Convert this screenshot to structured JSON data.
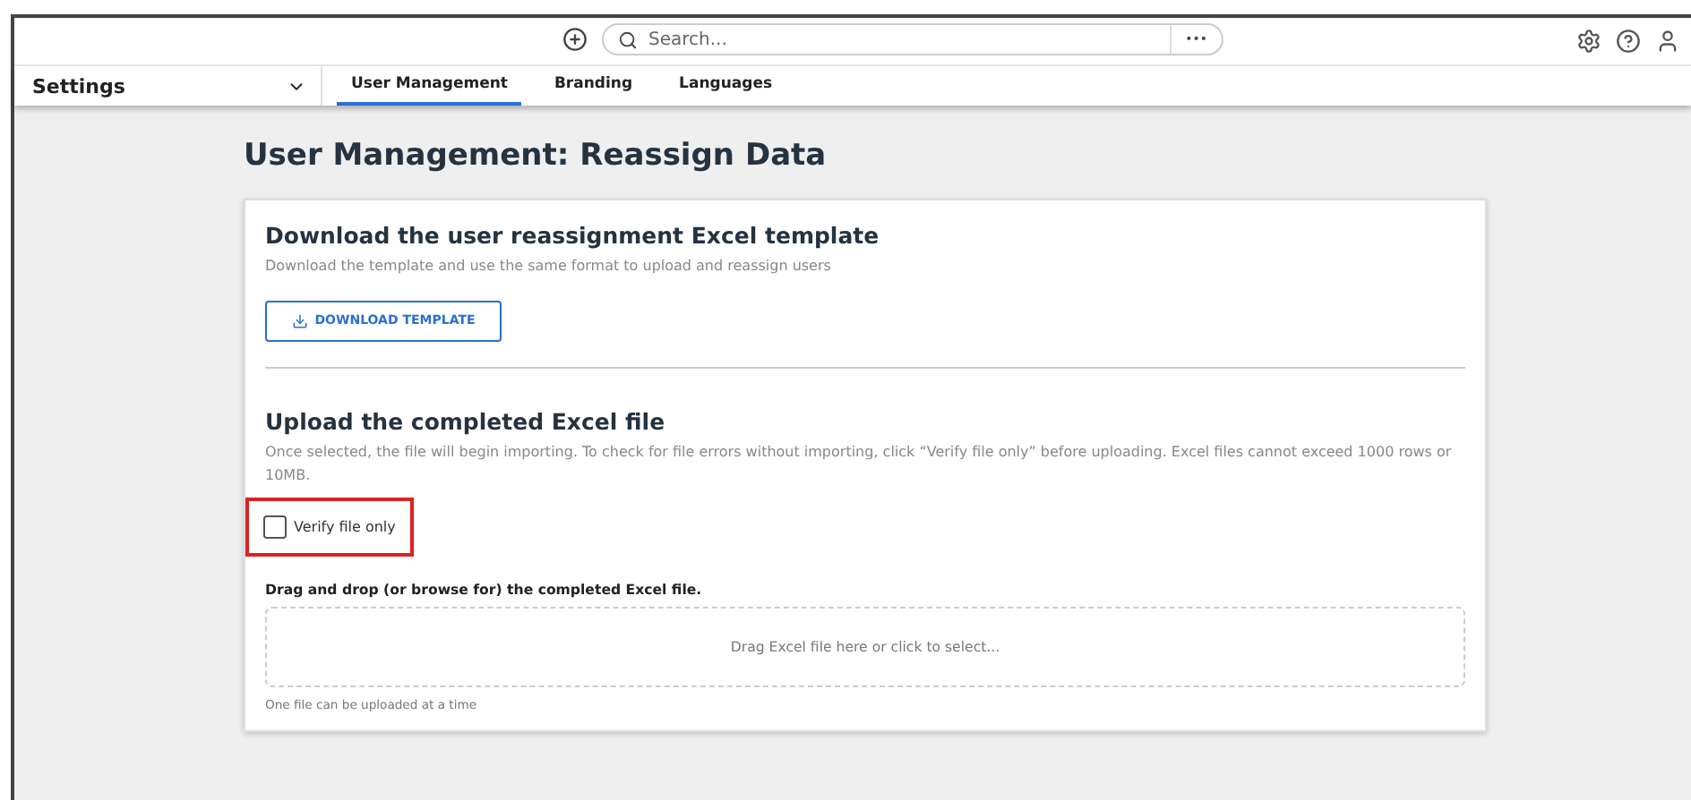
{
  "topbar": {
    "search": {
      "placeholder": "Search..."
    },
    "more": "•••"
  },
  "nav": {
    "title": "Settings",
    "tabs": [
      {
        "label": "User Management",
        "selected": true
      },
      {
        "label": "Branding",
        "selected": false
      },
      {
        "label": "Languages",
        "selected": false
      }
    ]
  },
  "page": {
    "title": "User Management: Reassign Data",
    "download": {
      "heading": "Download the user reassignment Excel template",
      "description": "Download the template and use the same format to upload and reassign users",
      "button": "DOWNLOAD TEMPLATE"
    },
    "upload": {
      "heading": "Upload the completed Excel file",
      "description": "Once selected, the file will begin importing. To check for file errors without importing, click “Verify file only” before uploading. Excel files cannot exceed 1000 rows or 10MB.",
      "verify": {
        "label": "Verify file only",
        "checked": false,
        "highlighted": true
      },
      "drop_label": "Drag and drop (or browse for) the completed Excel file.",
      "drop_zone": "Drag Excel file here or click to select...",
      "hint": "One file can be uploaded at a time"
    }
  }
}
